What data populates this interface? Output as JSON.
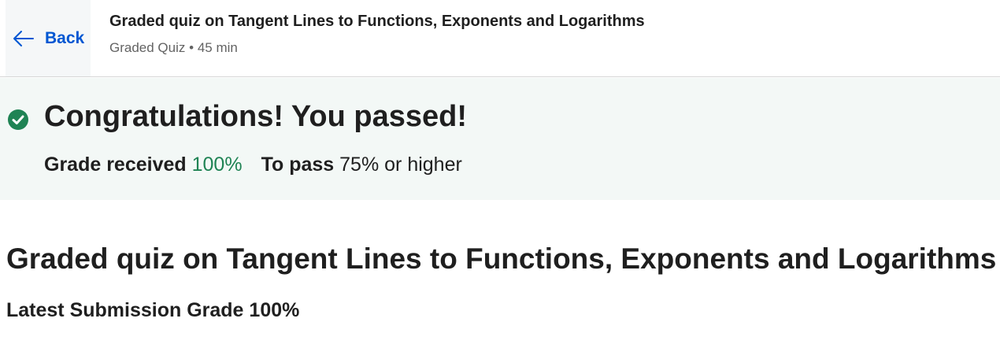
{
  "header": {
    "back_label": "Back",
    "title": "Graded quiz on Tangent Lines to Functions, Exponents and Logarithms",
    "type": "Graded Quiz",
    "separator": "•",
    "duration": "45 min"
  },
  "banner": {
    "heading": "Congratulations! You passed!",
    "grade_label": "Grade received",
    "grade_value": "100%",
    "pass_label": "To pass",
    "pass_value": "75% or higher"
  },
  "main": {
    "title": "Graded quiz on Tangent Lines to Functions, Exponents and Logarithms",
    "latest_label": "Latest Submission Grade",
    "latest_value": "100%"
  },
  "colors": {
    "link_blue": "#0056d2",
    "success_green": "#1f8354",
    "banner_bg": "#f3f8f6"
  },
  "icons": {
    "back": "arrow-left-icon",
    "status": "check-circle-icon"
  }
}
